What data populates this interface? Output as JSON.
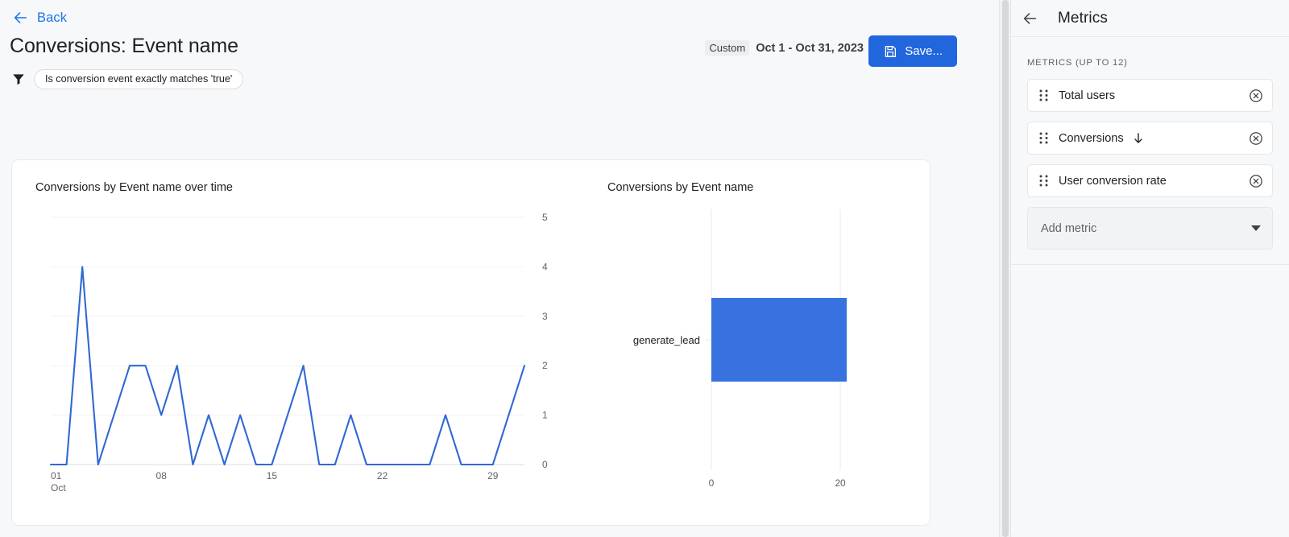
{
  "header": {
    "back_label": "Back",
    "back_icon": "arrow-left-icon",
    "page_title": "Conversions: Event name",
    "filter_icon": "funnel-icon",
    "filter_chip": "Is conversion event exactly matches 'true'",
    "date_range_badge": "Custom",
    "date_range": "Oct 1 - Oct 31, 2023",
    "save_label": "Save...",
    "save_icon": "save-disk-icon",
    "accent_color": "#2266DD"
  },
  "panel": {
    "back_icon": "arrow-left-icon",
    "title": "Metrics",
    "section_label": "METRICS (UP TO 12)",
    "metrics": [
      {
        "label": "Total users",
        "drag_icon": "drag-handle-icon",
        "remove_icon": "remove-circle-icon",
        "sort": ""
      },
      {
        "label": "Conversions",
        "drag_icon": "drag-handle-icon",
        "remove_icon": "remove-circle-icon",
        "sort": "descending"
      },
      {
        "label": "User conversion rate",
        "drag_icon": "drag-handle-icon",
        "remove_icon": "remove-circle-icon",
        "sort": ""
      }
    ],
    "add_metric_label": "Add metric",
    "add_metric_icon": "chevron-down-icon"
  },
  "chart_data": [
    {
      "type": "line",
      "title": "Conversions by Event name over time",
      "xlabel": "",
      "ylabel": "",
      "x": [
        "01",
        "02",
        "03",
        "04",
        "05",
        "06",
        "07",
        "08",
        "09",
        "10",
        "11",
        "12",
        "13",
        "14",
        "15",
        "16",
        "17",
        "18",
        "19",
        "20",
        "21",
        "22",
        "23",
        "24",
        "25",
        "26",
        "27",
        "28",
        "29",
        "30",
        "31"
      ],
      "x_tick_labels": [
        "01",
        "08",
        "15",
        "22",
        "29"
      ],
      "x_axis_sublabel": "Oct",
      "values": [
        0,
        0,
        4,
        0,
        1,
        2,
        2,
        1,
        2,
        0,
        1,
        0,
        1,
        0,
        0,
        1,
        2,
        0,
        0,
        1,
        0,
        0,
        0,
        0,
        0,
        1,
        0,
        0,
        0,
        1,
        2
      ],
      "y_ticks": [
        0,
        1,
        2,
        3,
        4,
        5
      ],
      "ylim": [
        0,
        5
      ],
      "grid": true,
      "legend": "none",
      "series_color": "#2F69D4"
    },
    {
      "type": "bar",
      "orientation": "horizontal",
      "title": "Conversions by Event name",
      "xlabel": "",
      "ylabel": "",
      "categories": [
        "generate_lead"
      ],
      "values": [
        21
      ],
      "x_ticks": [
        0,
        20
      ],
      "xlim": [
        0,
        25
      ],
      "grid": true,
      "legend": "none",
      "series_color": "#3772E0"
    }
  ]
}
